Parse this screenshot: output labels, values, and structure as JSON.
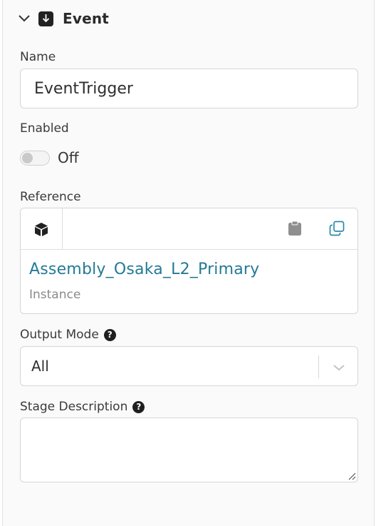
{
  "header": {
    "title": "Event",
    "chevron_icon": "chevron-down-icon",
    "event_icon": "arrow-down-square-icon"
  },
  "name": {
    "label": "Name",
    "value": "EventTrigger"
  },
  "enabled": {
    "label": "Enabled",
    "state_text": "Off",
    "checked": false
  },
  "reference": {
    "label": "Reference",
    "object_name": "Assembly_Osaka_L2_Primary",
    "object_type": "Instance",
    "icons": [
      "cube-icon",
      "clipboard-icon",
      "copy-icon"
    ]
  },
  "output_mode": {
    "label": "Output Mode",
    "help": "?",
    "value": "All"
  },
  "stage_description": {
    "label": "Stage Description",
    "help": "?",
    "value": ""
  },
  "colors": {
    "link": "#247a96",
    "icon_teal": "#2a8aa8",
    "dark": "#222222"
  }
}
